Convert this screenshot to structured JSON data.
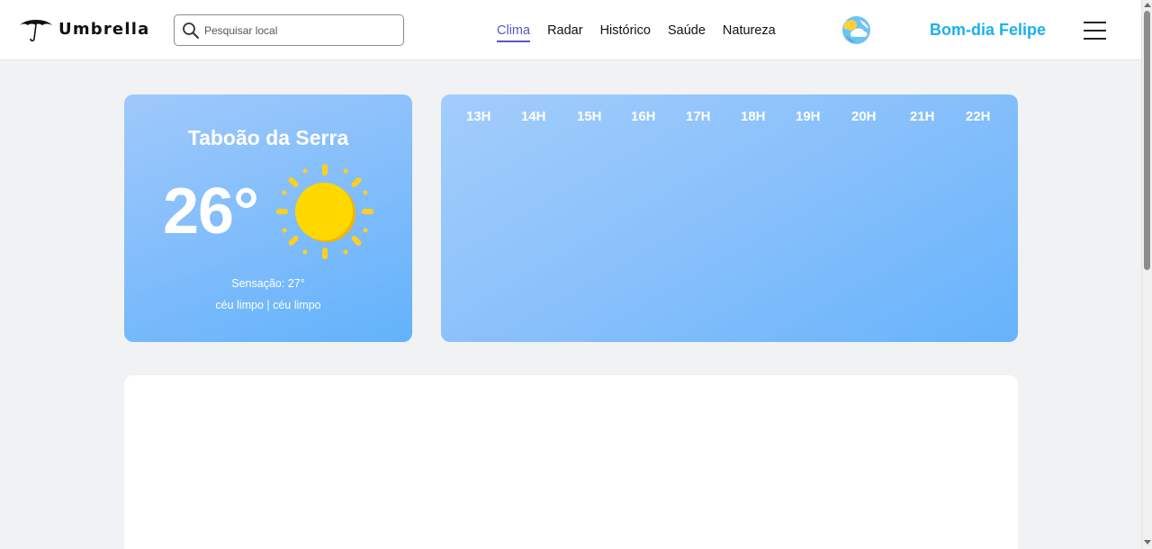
{
  "header": {
    "logo_text": "Umbrella",
    "search_placeholder": "Pesquisar local",
    "nav": [
      {
        "label": "Clima",
        "active": true
      },
      {
        "label": "Radar",
        "active": false
      },
      {
        "label": "Histórico",
        "active": false
      },
      {
        "label": "Saúde",
        "active": false
      },
      {
        "label": "Natureza",
        "active": false
      }
    ],
    "greeting": "Bom-dia Felipe"
  },
  "current": {
    "city": "Taboão da Serra",
    "temperature": "26°",
    "feels_like": "Sensação: 27°",
    "description": "céu limpo | céu limpo",
    "icon": "sun-icon"
  },
  "hourly": {
    "hours": [
      "13H",
      "14H",
      "15H",
      "16H",
      "17H",
      "18H",
      "19H",
      "20H",
      "21H",
      "22H"
    ]
  },
  "colors": {
    "accent_nav": "#5a55c8",
    "greeting": "#1ab2e8",
    "card_blue": "#7fbcfb",
    "sun_yellow": "#ffd400"
  }
}
